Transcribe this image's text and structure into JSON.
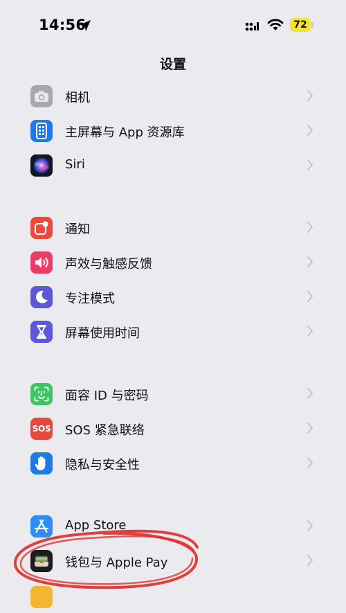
{
  "status_bar": {
    "time": "14:56",
    "battery": "72"
  },
  "nav": {
    "title": "设置"
  },
  "groups": [
    {
      "items": [
        {
          "label": "相机",
          "icon": "camera-icon",
          "color": "#a7a7ad"
        },
        {
          "label": "主屏幕与 App 资源库",
          "icon": "home-screen-icon",
          "color": "#1f7ae8"
        },
        {
          "label": "Siri",
          "icon": "siri-icon",
          "color": "#1a1a2e"
        }
      ]
    },
    {
      "items": [
        {
          "label": "通知",
          "icon": "notifications-icon",
          "color": "#ea4b3d"
        },
        {
          "label": "声效与触感反馈",
          "icon": "sounds-icon",
          "color": "#ea3c64"
        },
        {
          "label": "专注模式",
          "icon": "focus-moon-icon",
          "color": "#5f58d6"
        },
        {
          "label": "屏幕使用时间",
          "icon": "screen-time-hourglass-icon",
          "color": "#5f58d6"
        }
      ]
    },
    {
      "items": [
        {
          "label": "面容 ID 与密码",
          "icon": "face-id-icon",
          "color": "#3fc664"
        },
        {
          "label": "SOS 紧急联络",
          "icon": "sos-icon",
          "color": "#e24a3e",
          "icon_text": "SOS"
        },
        {
          "label": "隐私与安全性",
          "icon": "privacy-hand-icon",
          "color": "#1f7ae8"
        }
      ]
    },
    {
      "items": [
        {
          "label": "App Store",
          "icon": "app-store-icon",
          "color": "#2d8df1"
        },
        {
          "label": "钱包与 Apple Pay",
          "icon": "wallet-icon",
          "color": "#1c1c1e"
        }
      ]
    }
  ],
  "colors": {
    "background": "#ebeaef",
    "annotation_circle": "#e0302c",
    "chevron": "#c4c4c9"
  }
}
